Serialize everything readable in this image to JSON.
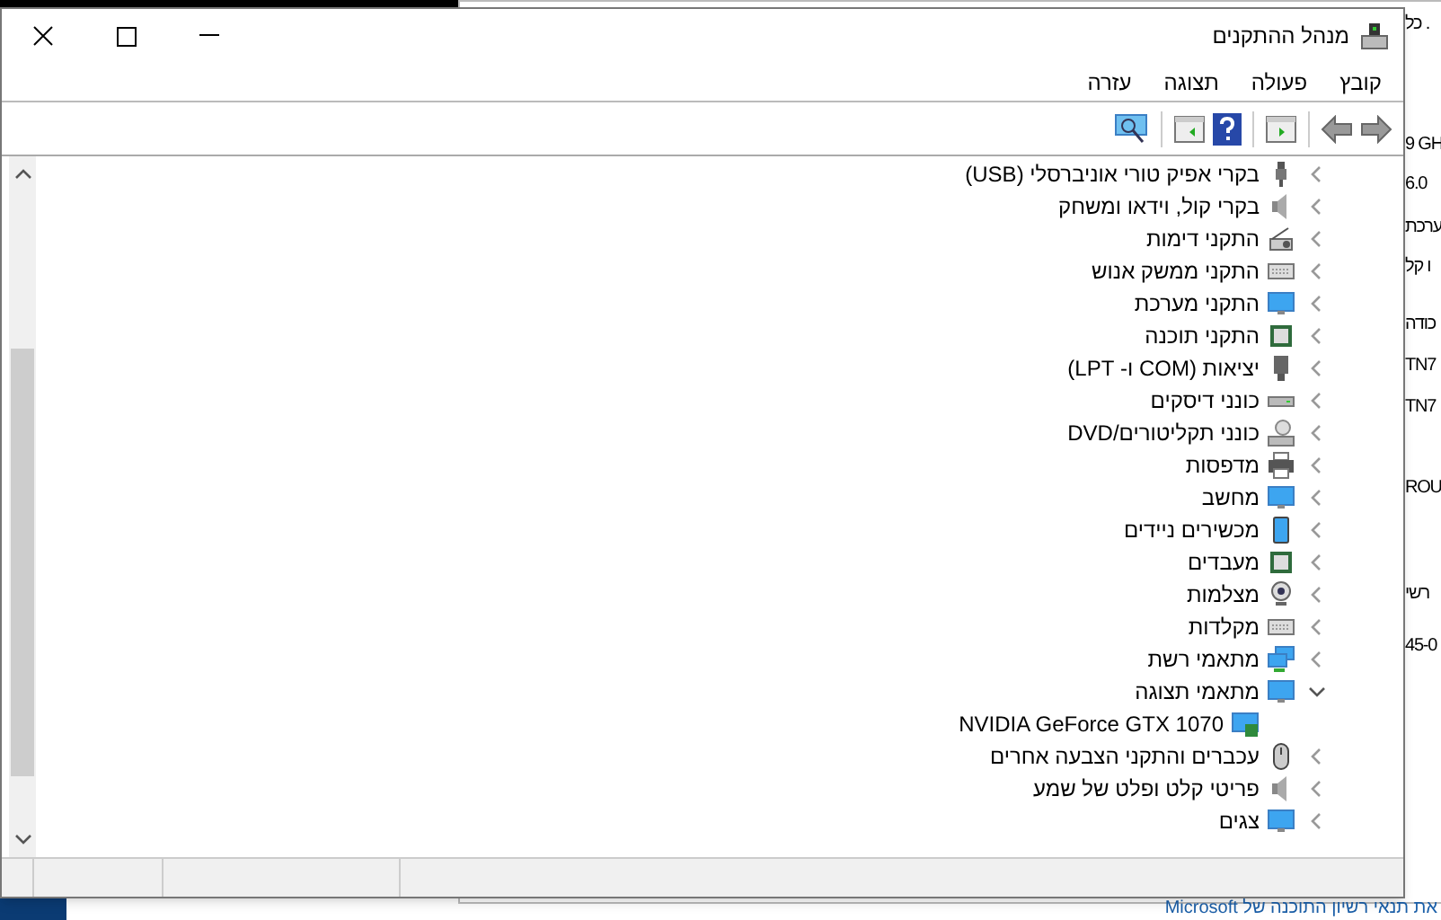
{
  "window": {
    "title": "מנהל ההתקנים"
  },
  "menu": [
    {
      "label": "קובץ"
    },
    {
      "label": "פעולה"
    },
    {
      "label": "תצוגה"
    },
    {
      "label": "עזרה"
    }
  ],
  "tree": [
    {
      "label": "בקרי אפיק טורי אוניברסלי (USB)",
      "expanded": false
    },
    {
      "label": "בקרי קול, וידאו ומשחק",
      "expanded": false
    },
    {
      "label": "התקני דימות",
      "expanded": false
    },
    {
      "label": "התקני ממשק אנוש",
      "expanded": false
    },
    {
      "label": "התקני מערכת",
      "expanded": false
    },
    {
      "label": "התקני תוכנה",
      "expanded": false
    },
    {
      "label": "יציאות (COM ו- LPT)",
      "expanded": false
    },
    {
      "label": "כונני דיסקים",
      "expanded": false
    },
    {
      "label": "כונני תקליטורים/DVD",
      "expanded": false
    },
    {
      "label": "מדפסות",
      "expanded": false
    },
    {
      "label": "מחשב",
      "expanded": false
    },
    {
      "label": "מכשירים ניידים",
      "expanded": false
    },
    {
      "label": "מעבדים",
      "expanded": false
    },
    {
      "label": "מצלמות",
      "expanded": false
    },
    {
      "label": "מקלדות",
      "expanded": false
    },
    {
      "label": "מתאמי רשת",
      "expanded": false
    },
    {
      "label": "מתאמי תצוגה",
      "expanded": true,
      "children": [
        {
          "label": "NVIDIA GeForce GTX 1070"
        }
      ]
    },
    {
      "label": "עכברים והתקני הצבעה אחרים",
      "expanded": false
    },
    {
      "label": "פריטי קלט ופלט של שמע",
      "expanded": false
    },
    {
      "label": "צגים",
      "expanded": false
    }
  ],
  "background": {
    "side_texts": [
      "כל .",
      "9 GH",
      "6.0",
      "ערכת",
      "ו קל",
      "כודה",
      "TN7",
      "TN7",
      "ROU",
      "רשי",
      "45-0"
    ],
    "footer_link": "את תנאי רשיון התוכנה של Microsoft"
  }
}
